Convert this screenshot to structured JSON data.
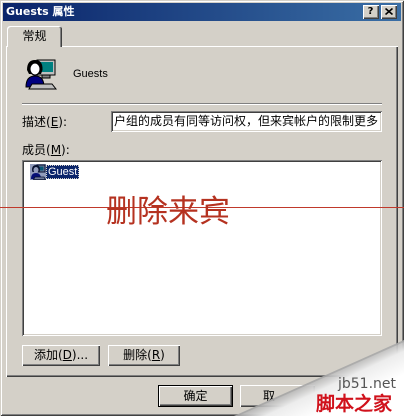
{
  "window": {
    "title": "Guests 属性",
    "help_glyph": "?",
    "help_icon": "help-icon",
    "close_icon": "close-icon"
  },
  "tabs": [
    {
      "label": "常规",
      "selected": true
    }
  ],
  "general_tab": {
    "group": {
      "name": "Guests",
      "icon": "users-group-icon"
    },
    "description": {
      "label": "描述(E):",
      "value": "户组的成员有同等访问权，但来宾帐户的限制更多"
    },
    "members": {
      "label": "成员(M):",
      "items": [
        {
          "name": "Guest",
          "icon": "user-icon",
          "selected": true
        }
      ]
    },
    "add_button": "添加(D)...",
    "remove_button": "删除(R)"
  },
  "dialog_buttons": {
    "ok": "确定",
    "cancel": "取"
  },
  "overlay_annotation": {
    "text": "删除来宾"
  },
  "watermark": {
    "site": "jb51.net",
    "name": "脚本之家"
  },
  "colors": {
    "face": "#d4d0c8",
    "title_start": "#0a246a",
    "title_end": "#3a6ea5",
    "selection": "#0a246a",
    "annotation_text": "#b53220",
    "annotation_line": "#c0392b",
    "watermark_red": "#d0111b"
  }
}
